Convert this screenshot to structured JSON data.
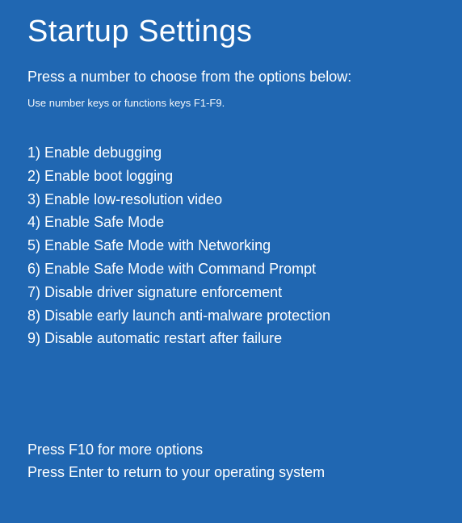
{
  "title": "Startup Settings",
  "subtitle": "Press a number to choose from the options below:",
  "hint": "Use number keys or functions keys F1-F9.",
  "options": [
    {
      "num": "1",
      "label": "Enable debugging"
    },
    {
      "num": "2",
      "label": "Enable boot logging"
    },
    {
      "num": "3",
      "label": "Enable low-resolution video"
    },
    {
      "num": "4",
      "label": "Enable Safe Mode"
    },
    {
      "num": "5",
      "label": "Enable Safe Mode with Networking"
    },
    {
      "num": "6",
      "label": "Enable Safe Mode with Command Prompt"
    },
    {
      "num": "7",
      "label": "Disable driver signature enforcement"
    },
    {
      "num": "8",
      "label": "Disable early launch anti-malware protection"
    },
    {
      "num": "9",
      "label": "Disable automatic restart after failure"
    }
  ],
  "footer": {
    "more_options": "Press F10 for more options",
    "return_line": "Press Enter to return to your operating system"
  }
}
